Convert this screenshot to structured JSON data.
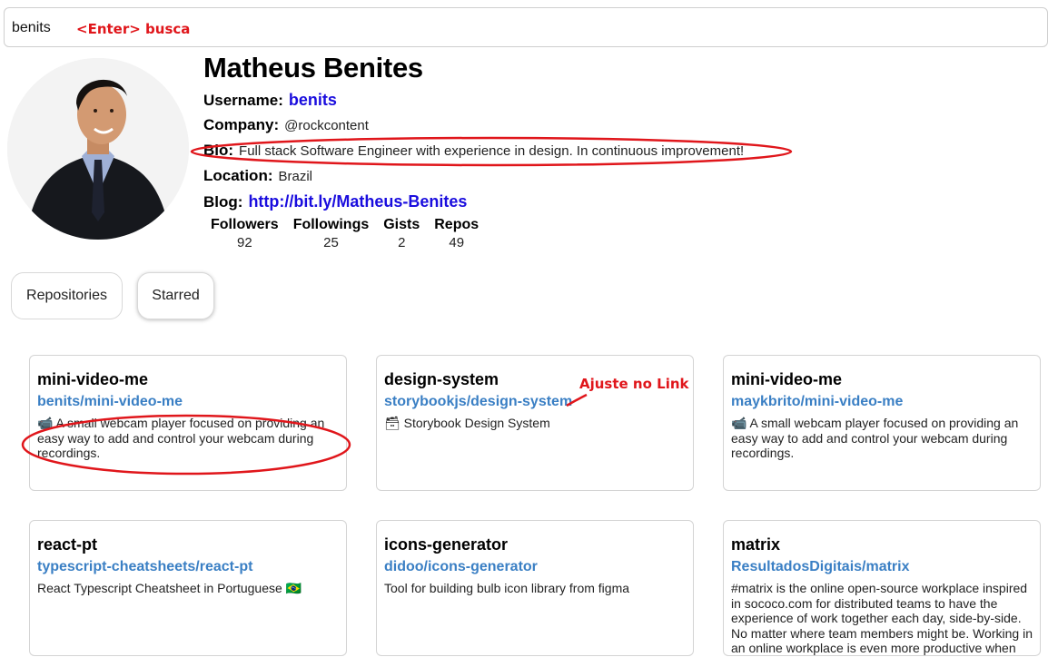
{
  "search": {
    "value": "benits",
    "annotation": "<Enter> busca"
  },
  "profile": {
    "name": "Matheus Benites",
    "username_label": "Username:",
    "username": "benits",
    "company_label": "Company:",
    "company": "@rockcontent",
    "bio_label": "Bio:",
    "bio": "Full stack Software Engineer with experience in design. In continuous improvement!",
    "location_label": "Location:",
    "location": "Brazil",
    "blog_label": "Blog:",
    "blog": "http://bit.ly/Matheus-Benites"
  },
  "stats": [
    {
      "label": "Followers",
      "value": "92"
    },
    {
      "label": "Followings",
      "value": "25"
    },
    {
      "label": "Gists",
      "value": "2"
    },
    {
      "label": "Repos",
      "value": "49"
    }
  ],
  "tabs": {
    "repositories": "Repositories",
    "starred": "Starred"
  },
  "cards": [
    {
      "title": "mini-video-me",
      "link": "benits/mini-video-me",
      "description": "📹 A small webcam player focused on providing an easy way to add and control your webcam during recordings."
    },
    {
      "title": "design-system",
      "link": "storybookjs/design-system",
      "description": "🗃 Storybook Design System"
    },
    {
      "title": "mini-video-me",
      "link": "maykbrito/mini-video-me",
      "description": "📹 A small webcam player focused on providing an easy way to add and control your webcam during recordings."
    },
    {
      "title": "react-pt",
      "link": "typescript-cheatsheets/react-pt",
      "description": "React Typescript Cheatsheet in Portuguese 🇧🇷"
    },
    {
      "title": "icons-generator",
      "link": "didoo/icons-generator",
      "description": "Tool for building bulb icon library from figma"
    },
    {
      "title": "matrix",
      "link": "ResultadosDigitais/matrix",
      "description": "#matrix is the online open-source workplace inspired in sococo.com for distributed teams to have the experience of work together each day, side-by-side. No matter where team members might be. Working in an online workplace is even more productive when"
    }
  ],
  "annotations": {
    "link_fix": "Ajuste no Link",
    "color": "#e0161b"
  },
  "colors": {
    "username_link": "#1a0dde",
    "repo_link": "#3a7fc4"
  }
}
